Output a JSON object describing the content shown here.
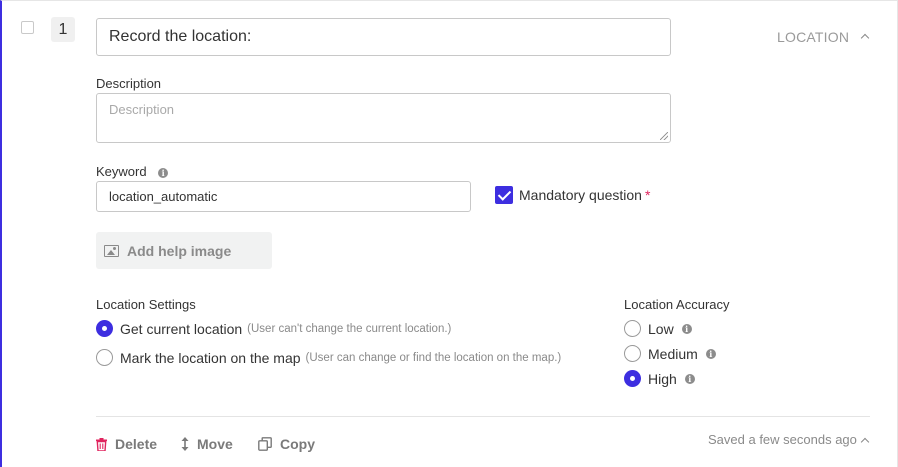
{
  "question": {
    "number": "1",
    "title": "Record the location:",
    "type_label": "LOCATION"
  },
  "description": {
    "label": "Description",
    "placeholder": "Description"
  },
  "keyword": {
    "label": "Keyword",
    "value": "location_automatic"
  },
  "mandatory": {
    "label": "Mandatory question",
    "asterisk": "*",
    "checked": true
  },
  "help_image": {
    "label": "Add help image"
  },
  "location_settings": {
    "label": "Location Settings",
    "options": [
      {
        "label": "Get current location",
        "hint": "(User can't change the current location.)",
        "selected": true
      },
      {
        "label": "Mark the location on the map",
        "hint": "(User can change or find the location on the map.)",
        "selected": false
      }
    ]
  },
  "location_accuracy": {
    "label": "Location Accuracy",
    "options": [
      {
        "label": "Low",
        "selected": false
      },
      {
        "label": "Medium",
        "selected": false
      },
      {
        "label": "High",
        "selected": true
      }
    ]
  },
  "footer": {
    "delete_label": "Delete",
    "move_label": "Move",
    "copy_label": "Copy",
    "saved_status": "Saved a few seconds ago"
  },
  "colors": {
    "accent": "#3d2ee0",
    "delete_icon": "#e0245e"
  }
}
